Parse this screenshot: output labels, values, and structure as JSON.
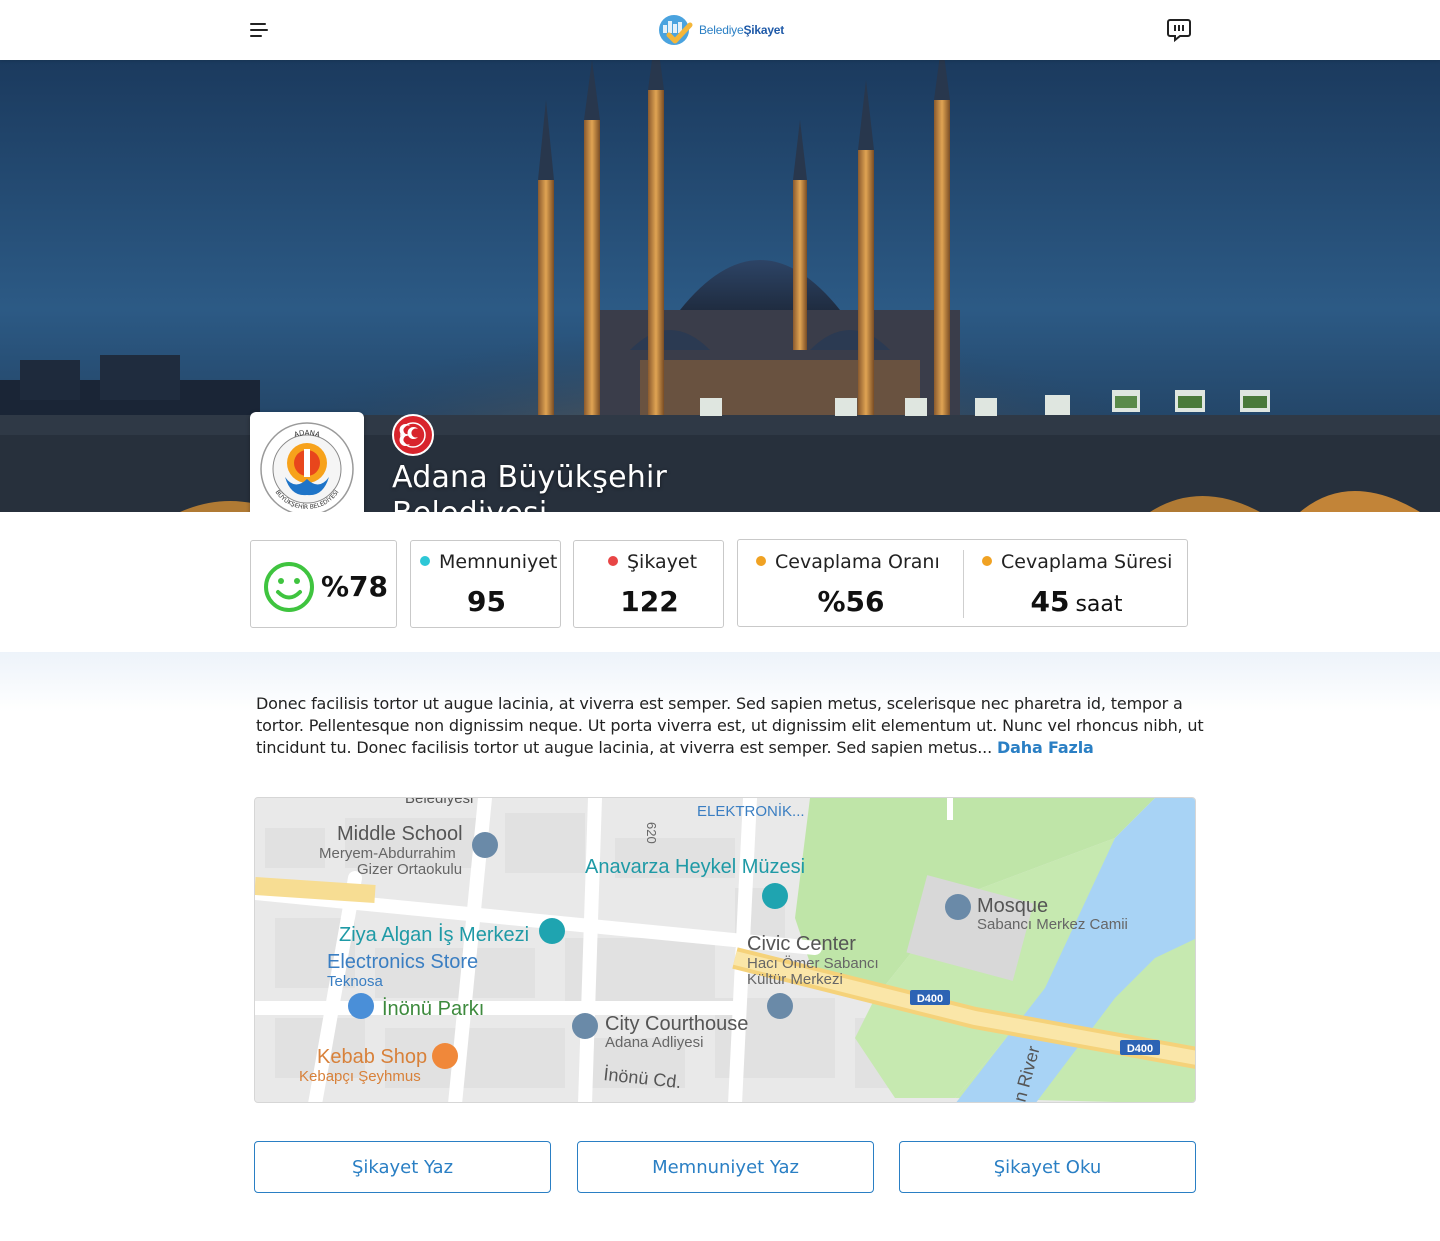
{
  "header": {
    "logo_prefix": "Belediye",
    "logo_suffix": "Şikayet",
    "menu_icon": "hamburger-menu-icon",
    "chat_icon": "chat-bubble-icon"
  },
  "hero": {
    "municipality_name": "Adana Büyükşehir Belediyesi",
    "emblem_top_text": "ADANA",
    "emblem_ring_text": "BÜYÜKŞEHİR BELEDİYESİ",
    "party_icon": "mhp-party-logo-icon"
  },
  "stats": {
    "satisfaction_percent": "%78",
    "satisfaction_icon": "smiley-face-icon",
    "memnuniyet": {
      "label": "Memnuniyet",
      "value": "95",
      "dot_color": "#2dc7d6"
    },
    "sikayet": {
      "label": "Şikayet",
      "value": "122",
      "dot_color": "#e84545"
    },
    "cevaplama_orani": {
      "label": "Cevaplama Oranı",
      "value": "%56",
      "dot_color": "#f0a223"
    },
    "cevaplama_suresi": {
      "label": "Cevaplama Süresi",
      "value": "45",
      "unit": "saat",
      "dot_color": "#f0a223"
    }
  },
  "description": {
    "text": "Donec facilisis tortor ut augue lacinia, at viverra est semper. Sed sapien metus, scelerisque nec pharetra id, tempor a tortor. Pellentesque non dignissim neque. Ut porta viverra est, ut dignissim elit elementum ut. Nunc vel rhoncus nibh, ut tincidunt tu. Donec facilisis tortor ut augue lacinia, at viverra est semper. Sed sapien metus...",
    "more_label": "Daha Fazla"
  },
  "map": {
    "labels": {
      "belediyesi": "Belediyesi",
      "road_620": "620",
      "elektronik": "ELEKTRONİK...",
      "middle_school": "Middle School",
      "meryem": "Meryem-Abdurrahim",
      "gizer": "Gizer Ortaokulu",
      "anavarza": "Anavarza Heykel Müzesi",
      "mosque": "Mosque",
      "sabanci_camii": "Sabancı Merkez Camii",
      "ziya": "Ziya Algan İş Merkezi",
      "civic": "Civic Center",
      "haci_omer": "Hacı Ömer Sabancı",
      "kultur": "Kültür Merkezi",
      "electronics": "Electronics Store",
      "teknosa": "Teknosa",
      "inonu_parki": "İnönü Parkı",
      "city_courthouse": "City Courthouse",
      "adana_adliyesi": "Adana Adliyesi",
      "kebab": "Kebab Shop",
      "kebapci": "Kebapçı Şeyhmus",
      "inonu_cd": "İnönü Cd.",
      "d400_a": "D400",
      "d400_b": "D400",
      "river": "n River"
    }
  },
  "actions": {
    "sikayet_yaz": "Şikayet Yaz",
    "memnuniyet_yaz": "Memnuniyet Yaz",
    "sikayet_oku": "Şikayet Oku"
  },
  "colors": {
    "accent": "#2a7fc4",
    "smiley": "#3fc43f"
  }
}
